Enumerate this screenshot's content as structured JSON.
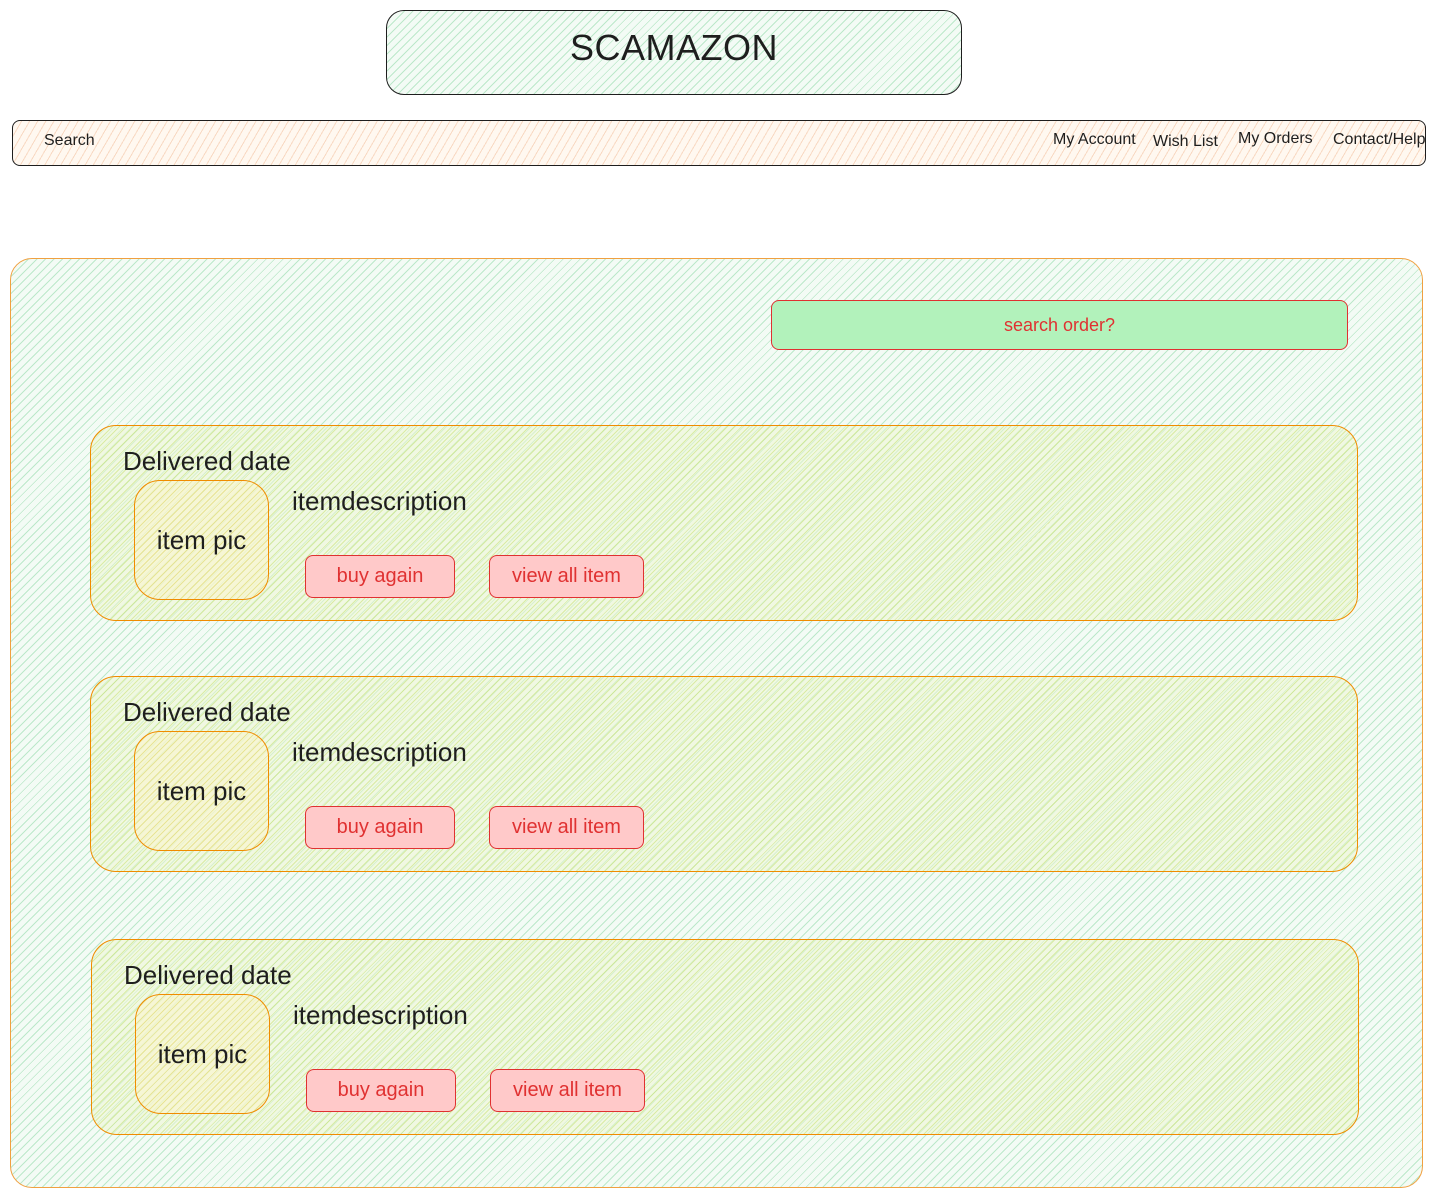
{
  "header": {
    "logo": "SCAMAZON"
  },
  "navbar": {
    "search_label": "Search",
    "links": {
      "my_account": "My Account",
      "wish_list": "Wish List",
      "my_orders": "My Orders",
      "contact_help": "Contact/Help"
    }
  },
  "main": {
    "search_order_label": "search order?",
    "orders": [
      {
        "delivered_date": "Delivered date",
        "item_pic": "item pic",
        "item_description": "itemdescription",
        "buy_again": "buy again",
        "view_all": "view all item"
      },
      {
        "delivered_date": "Delivered date",
        "item_pic": "item pic",
        "item_description": "itemdescription",
        "buy_again": "buy again",
        "view_all": "view all item"
      },
      {
        "delivered_date": "Delivered date",
        "item_pic": "item pic",
        "item_description": "itemdescription",
        "buy_again": "buy again",
        "view_all": "view all item"
      }
    ]
  },
  "colors": {
    "panel_stroke": "#f0a040",
    "card_stroke": "#f08c00",
    "button_fill": "#ffc9c9",
    "button_stroke": "#e03131",
    "search_order_fill": "#b2f2bb"
  }
}
